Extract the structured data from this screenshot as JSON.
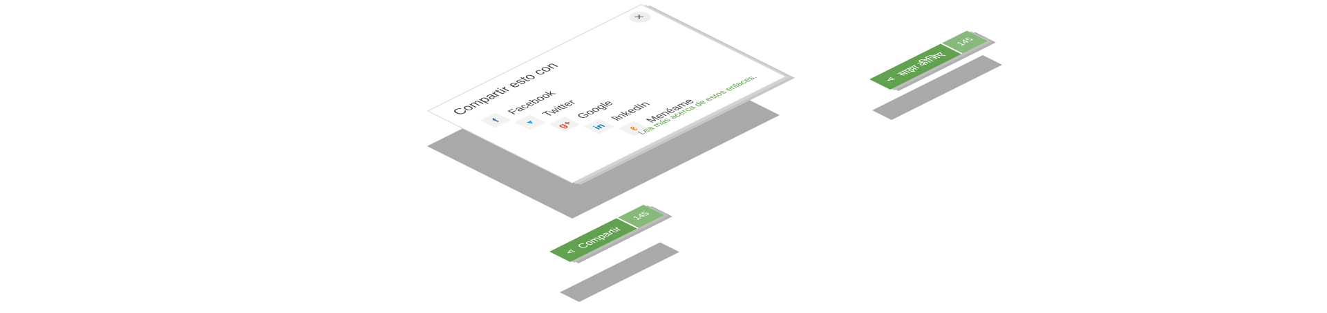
{
  "popup": {
    "title": "Compartir esto con",
    "close_label": "×",
    "items": [
      {
        "icon": "facebook-icon",
        "glyph": "f",
        "color": "#3b5998",
        "label": "Facebook"
      },
      {
        "icon": "twitter-icon",
        "glyph": "🐦",
        "color": "#1da1f2",
        "label": "Twitter"
      },
      {
        "icon": "google-plus-icon",
        "glyph": "g+",
        "color": "#dd4b39",
        "label": "Google"
      },
      {
        "icon": "linkedin-icon",
        "glyph": "in",
        "color": "#0077b5",
        "label": "linkedIn"
      },
      {
        "icon": "meneame-icon",
        "glyph": "ℓ",
        "color": "#f08a24",
        "label": "Menéame"
      }
    ],
    "more_link": "Lea más acerca de estos enlaces."
  },
  "share_button_es": {
    "label": "Compartir",
    "count": "145",
    "icon": "share-icon"
  },
  "share_button_hi": {
    "label": "साझा कीजिए",
    "count": "145",
    "icon": "share-icon"
  },
  "colors": {
    "accent": "#62a14f",
    "accent_light": "#87b97a",
    "shadow": "#a9a9a9",
    "link": "#5a9e47"
  }
}
